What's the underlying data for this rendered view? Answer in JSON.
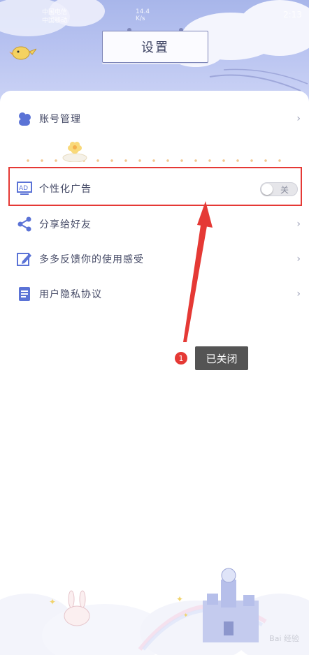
{
  "status_bar": {
    "carrier1": "中国电信",
    "carrier2": "中国移动",
    "net_speed": "14.4",
    "net_unit": "K/s",
    "time": "2:13"
  },
  "header": {
    "title": "设置"
  },
  "menu": {
    "account": "账号管理",
    "personal_ads": "个性化广告",
    "share": "分享给好友",
    "feedback": "多多反馈你的使用感受",
    "privacy": "用户隐私协议",
    "chevron": "›"
  },
  "toggle": {
    "state_label": "关",
    "on": false
  },
  "annotation": {
    "number": "1",
    "text": "已关闭"
  },
  "watermark": "Bai 经验",
  "colors": {
    "icon_blue": "#5b73d6",
    "highlight_red": "#e53935"
  }
}
